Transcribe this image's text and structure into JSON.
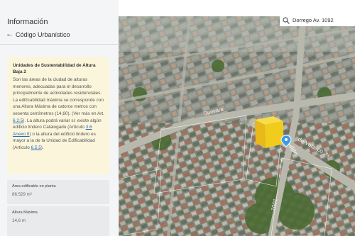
{
  "panel": {
    "title": "Información",
    "nav_label": "Código Urbanístico"
  },
  "card": {
    "title": "Unidades de Sustentabilidad de Altura Baja 2",
    "text_1": "Son las áreas de la ciudad de alturas menores, adecuadas para el desarrollo principalmente de actividades residenciales. La edificabilidad máxima se corresponde con una Altura Máxima de catorce metros con sesenta centímetros (14,60). (Ver más en Art. ",
    "link_1": "6.2.5",
    "text_2": "). La altura podrá variar si: existe algún edificio lindero Catalogado (Artículo ",
    "link_2": "3.6 Anexo II",
    "text_3": ") o la altura del edificio lindero es mayor a la de la Unidad de Edificabilidad (Artículo ",
    "link_3": "6.5.5",
    "text_4": ")."
  },
  "stats": [
    {
      "label": "Área edificable en planta",
      "value": "86.529 m²"
    },
    {
      "label": "Altura Máxima",
      "value": "14,6 m"
    }
  ],
  "search": {
    "value": "Dorrego Av. 1092"
  },
  "map": {
    "street_labels": [
      "Guevara",
      "de Velasco Ju",
      "1001"
    ]
  },
  "colors": {
    "card_bg": "#fbf5dc",
    "link": "#1f6bbd",
    "parcel_highlight": "#f2cc1c",
    "marker": "#3d9be9"
  }
}
